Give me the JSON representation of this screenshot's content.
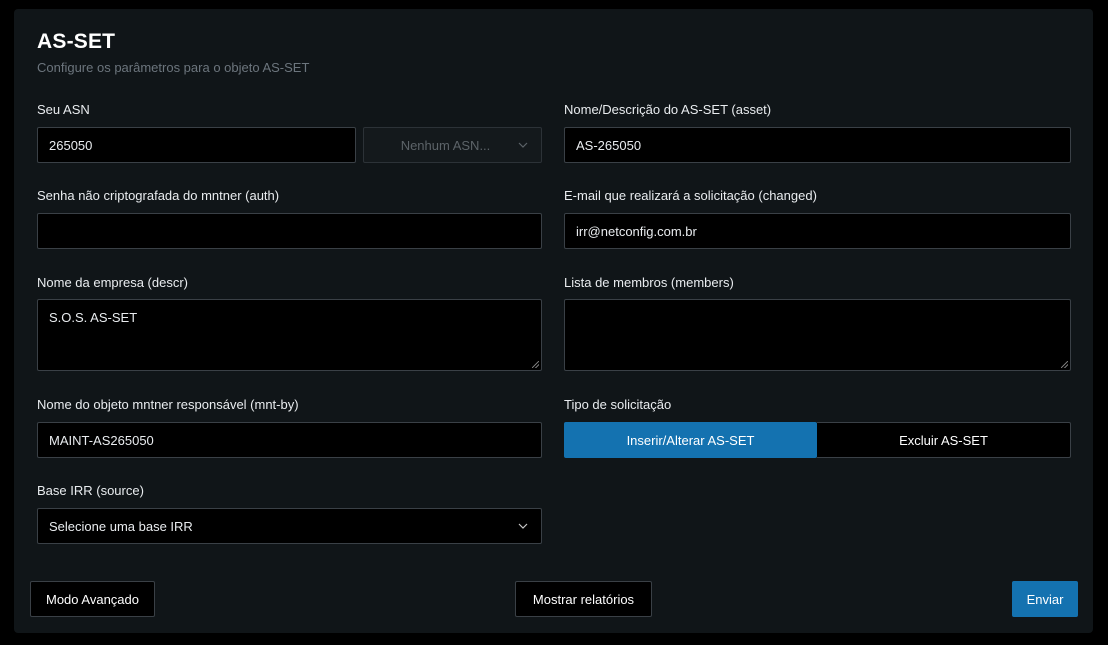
{
  "header": {
    "title": "AS-SET",
    "subtitle": "Configure os parâmetros para o objeto AS-SET"
  },
  "fields": {
    "asn": {
      "label": "Seu ASN",
      "value": "265050"
    },
    "asn_select": {
      "value": "Nenhum ASN..."
    },
    "asset_name": {
      "label": "Nome/Descrição do AS-SET (asset)",
      "value": "AS-265050"
    },
    "auth": {
      "label": "Senha não criptografada do mntner (auth)",
      "value": ""
    },
    "changed": {
      "label": "E-mail que realizará a solicitação (changed)",
      "value": "irr@netconfig.com.br"
    },
    "descr": {
      "label": "Nome da empresa (descr)",
      "value": "S.O.S. AS-SET"
    },
    "members": {
      "label": "Lista de membros (members)",
      "value": ""
    },
    "mnt_by": {
      "label": "Nome do objeto mntner responsável (mnt-by)",
      "value": "MAINT-AS265050"
    },
    "request_type": {
      "label": "Tipo de solicitação",
      "options": [
        "Inserir/Alterar AS-SET",
        "Excluir AS-SET"
      ],
      "selected": "Inserir/Alterar AS-SET"
    },
    "source": {
      "label": "Base IRR (source)",
      "value": "Selecione uma base IRR"
    }
  },
  "actions": {
    "advanced": "Modo Avançado",
    "reports": "Mostrar relatórios",
    "submit": "Enviar"
  },
  "colors": {
    "accent": "#1472b0",
    "card": "#101518",
    "background": "#000000"
  }
}
